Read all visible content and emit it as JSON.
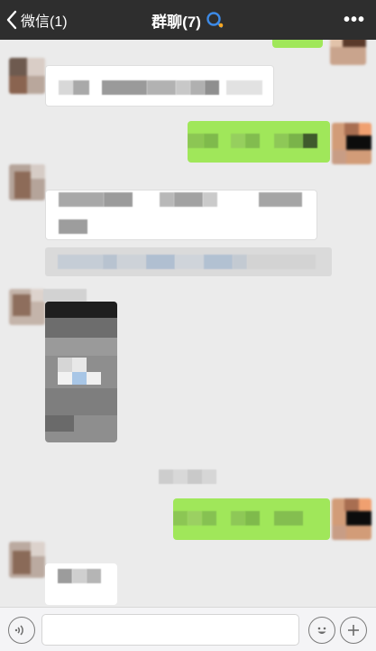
{
  "nav": {
    "back_label": "微信(1)",
    "title": "群聊(7)",
    "more_label": "•••"
  },
  "input": {
    "value": ""
  },
  "colors": {
    "nav_bg": "#2e2e2e",
    "chat_bg": "#ebebeb",
    "bubble_sent": "#a0e75a",
    "bubble_received": "#ffffff"
  },
  "icons": {
    "back": "chevron-left-icon",
    "group_tag": "group-chat-icon",
    "more": "more-dots-icon",
    "voice": "voice-icon",
    "emoji": "emoji-icon",
    "plus": "plus-icon"
  }
}
